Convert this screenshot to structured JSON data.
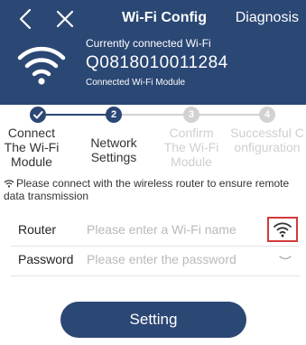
{
  "header": {
    "title": "Wi-Fi Config",
    "diagnosis_label": "Diagnosis",
    "back_icon": "chevron-left-icon",
    "close_icon": "close-icon",
    "connection": {
      "label": "Currently connected Wi-Fi",
      "ssid": "Q0818010011284",
      "module_label": "Connected Wi-Fi Module",
      "icon": "wifi-icon"
    }
  },
  "steps": {
    "current_step": 2,
    "items": [
      {
        "number": "1",
        "label": "Connect The Wi-Fi Module",
        "status": "done"
      },
      {
        "number": "2",
        "label": "Network Settings",
        "status": "active"
      },
      {
        "number": "3",
        "label": "Confirm The Wi-Fi Module",
        "status": "pending"
      },
      {
        "number": "4",
        "label": "Successful Configuration",
        "status": "pending"
      }
    ]
  },
  "hint": "Please connect with the wireless router to ensure remote data transmission",
  "form": {
    "router": {
      "label": "Router",
      "placeholder": "Please enter a Wi-Fi name",
      "value": ""
    },
    "password": {
      "label": "Password",
      "placeholder": "Please enter the password",
      "value": ""
    }
  },
  "setting_button_label": "Setting",
  "colors": {
    "header_bg": "#2b4774",
    "step_active": "#2b4774",
    "step_pending": "#d2d2d2",
    "highlight_border": "#d23a3a"
  }
}
